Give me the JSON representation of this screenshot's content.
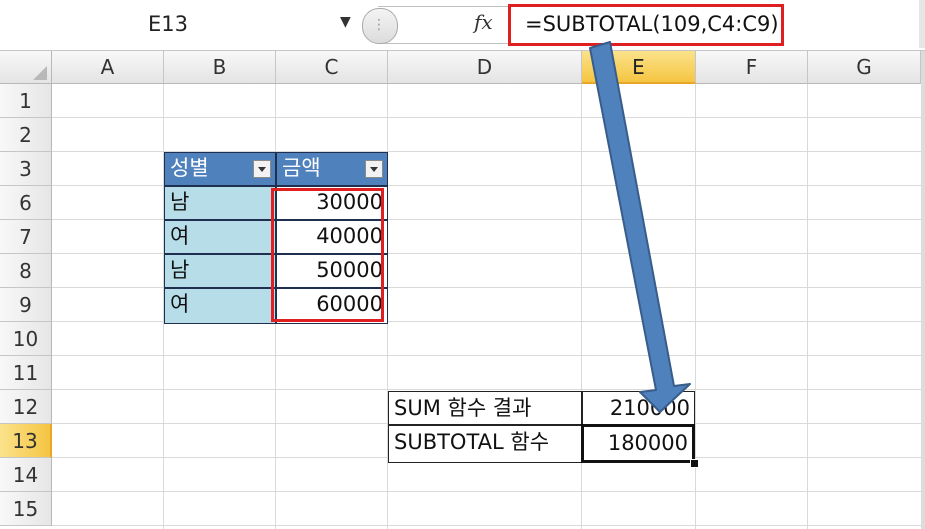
{
  "formula_bar": {
    "name_box": "E13",
    "fx_label": "fx",
    "formula": "=SUBTOTAL(109,C4:C9)"
  },
  "columns": [
    "A",
    "B",
    "C",
    "D",
    "E",
    "F",
    "G"
  ],
  "active_column": "E",
  "rows": [
    "1",
    "2",
    "3",
    "6",
    "7",
    "8",
    "9",
    "10",
    "11",
    "12",
    "13",
    "14",
    "15"
  ],
  "active_row": "13",
  "table": {
    "headers": [
      "성별",
      "금액"
    ],
    "rows": [
      {
        "gender": "남",
        "amount": "30000"
      },
      {
        "gender": "여",
        "amount": "40000"
      },
      {
        "gender": "남",
        "amount": "50000"
      },
      {
        "gender": "여",
        "amount": "60000"
      }
    ]
  },
  "results": {
    "sum_label": "SUM 함수 결과",
    "sum_value": "210000",
    "subtotal_label": "SUBTOTAL 함수",
    "subtotal_value": "180000"
  },
  "colors": {
    "table_header": "#4f81bd",
    "table_body": "#b7dee8",
    "highlight_red": "#e02020",
    "arrow_blue": "#4f81bd"
  }
}
